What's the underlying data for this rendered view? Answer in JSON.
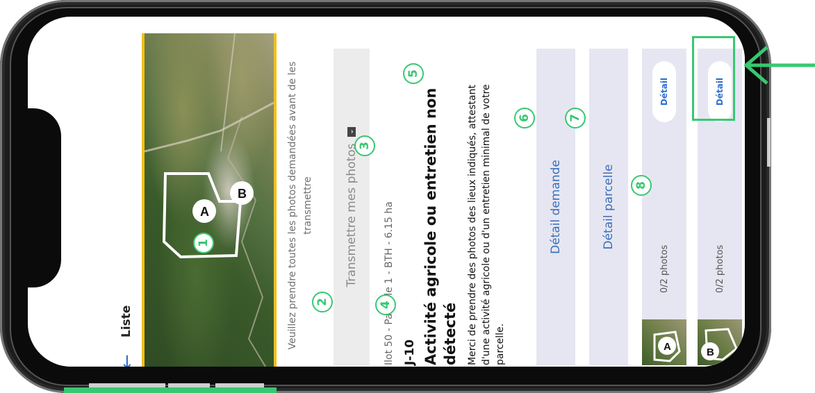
{
  "topbar": {
    "back_icon": "←",
    "title": "Liste"
  },
  "map": {
    "labels": [
      "A",
      "B"
    ]
  },
  "instructions": "Veuillez prendre toutes les photos demandées avant de les transmettre",
  "send_button": {
    "label": "Transmettre mes photos"
  },
  "parcel_meta": "Ilot 50 - Parcelle 1 - BTH - 6.15 ha",
  "deadline": "J-10",
  "heading": "Activité agricole ou entretien non détecté",
  "description": "Merci de prendre des photos des lieux indiqués, attestant d'une activité agricole ou d'un entretien minimal de votre parcelle.",
  "panels": {
    "request_detail": "Détail demande",
    "parcel_detail": "Détail parcelle"
  },
  "photo_rows": [
    {
      "label": "A",
      "count": "0/2 photos",
      "button": "Détail"
    },
    {
      "label": "B",
      "count": "0/2 photos",
      "button": "Détail"
    }
  ],
  "annotations": [
    "1",
    "2",
    "3",
    "4",
    "5",
    "6",
    "7",
    "8"
  ],
  "colors": {
    "accent_green": "#37c871",
    "link_blue": "#2f6fd1",
    "map_border": "#f2c019",
    "panel_bg": "#e6e6f2"
  }
}
